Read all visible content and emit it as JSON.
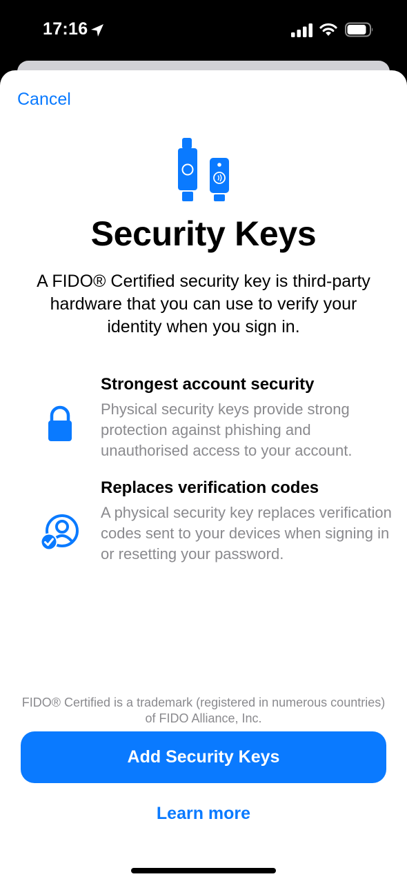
{
  "status_bar": {
    "time": "17:16",
    "icons": [
      "location-arrow-icon",
      "cellular-signal-icon",
      "wifi-icon",
      "battery-icon"
    ]
  },
  "sheet": {
    "cancel_label": "Cancel",
    "hero_icon": "security-keys-icon",
    "title": "Security Keys",
    "intro": "A FIDO® Certified security key is third-party hardware that you can use to verify your identity when you sign in.",
    "features": [
      {
        "icon": "lock-icon",
        "title": "Strongest account security",
        "description": "Physical security keys provide strong protection against phishing and unauthorised access to your account."
      },
      {
        "icon": "person-checkmark-icon",
        "title": "Replaces verification codes",
        "description": "A physical security key replaces verification codes sent to your devices when signing in or resetting your password."
      }
    ],
    "trademark_note": "FIDO® Certified is a trademark (registered in numerous countries) of FIDO Alliance, Inc.",
    "primary_button_label": "Add Security Keys",
    "learn_more_label": "Learn more"
  },
  "colors": {
    "accent": "#0a7aff",
    "secondary_text": "#8a8a8e",
    "background": "#ffffff",
    "status_bar_background": "#000000"
  }
}
